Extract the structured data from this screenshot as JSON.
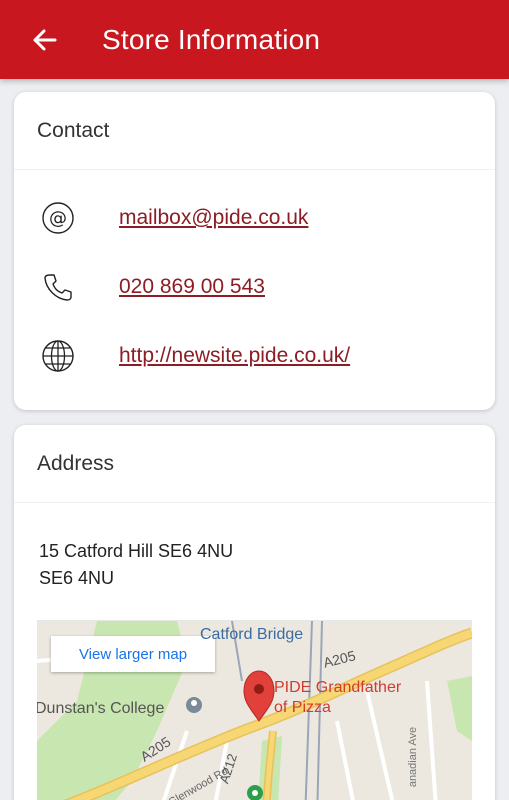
{
  "appbar": {
    "title": "Store Information",
    "back_icon": "arrow-back-icon"
  },
  "contact": {
    "header": "Contact",
    "email": {
      "icon": "at-icon",
      "value": "mailbox@pide.co.uk"
    },
    "phone": {
      "icon": "phone-icon",
      "value": "020 869 00 543"
    },
    "website": {
      "icon": "globe-icon",
      "value": "http://newsite.pide.co.uk/"
    }
  },
  "address": {
    "header": "Address",
    "line1": "15 Catford Hill SE6 4NU",
    "line2": "SE6 4NU"
  },
  "map": {
    "view_larger_label": "View larger map",
    "labels": {
      "catford_bridge": "Catford Bridge",
      "a205_top": "A205",
      "pide_line1": "PIDE Grandfather",
      "pide_line2": "of Pizza",
      "college": "Dunstan's College",
      "a205_left": "A205",
      "glenwood": "Glenwood Rd",
      "a212": "A212",
      "canadian": "anadian Ave"
    },
    "colors": {
      "road": "#f7d774",
      "park": "#c8e6b0",
      "marker": "#e2403a",
      "rail": "#9aa6b8"
    }
  },
  "colors": {
    "appbar": "#c8171e",
    "link": "#8c1d25",
    "background": "#eceef1"
  }
}
